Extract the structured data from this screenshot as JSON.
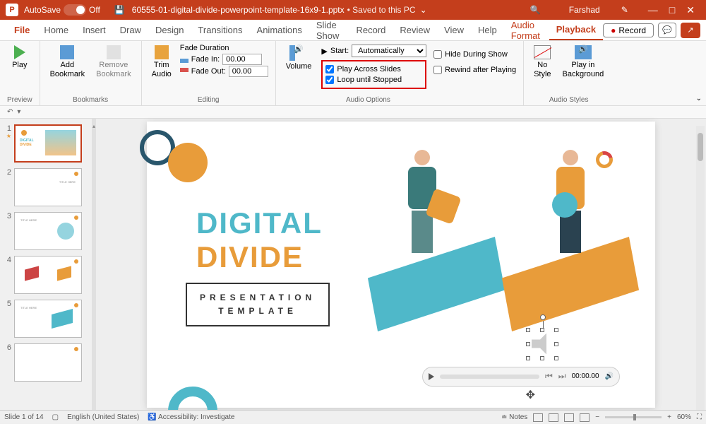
{
  "titlebar": {
    "autosave_label": "AutoSave",
    "autosave_state": "Off",
    "filename": "60555-01-digital-divide-powerpoint-template-16x9-1.pptx",
    "saved_status": "• Saved to this PC",
    "user": "Farshad"
  },
  "tabs": {
    "file": "File",
    "home": "Home",
    "insert": "Insert",
    "draw": "Draw",
    "design": "Design",
    "transitions": "Transitions",
    "animations": "Animations",
    "slideshow": "Slide Show",
    "record": "Record",
    "review": "Review",
    "view": "View",
    "help": "Help",
    "audio_format": "Audio Format",
    "playback": "Playback",
    "record_btn": "Record"
  },
  "ribbon": {
    "preview": {
      "play": "Play",
      "group": "Preview"
    },
    "bookmarks": {
      "add": "Add\nBookmark",
      "remove": "Remove\nBookmark",
      "group": "Bookmarks"
    },
    "editing": {
      "trim": "Trim\nAudio",
      "fade_duration": "Fade Duration",
      "fade_in_label": "Fade In:",
      "fade_in_val": "00.00",
      "fade_out_label": "Fade Out:",
      "fade_out_val": "00.00",
      "group": "Editing"
    },
    "audio_options": {
      "volume": "Volume",
      "start_label": "Start:",
      "start_val": "Automatically",
      "play_across": "Play Across Slides",
      "loop": "Loop until Stopped",
      "hide": "Hide During Show",
      "rewind": "Rewind after Playing",
      "group": "Audio Options"
    },
    "audio_styles": {
      "no_style": "No\nStyle",
      "play_bg": "Play in\nBackground",
      "group": "Audio Styles"
    }
  },
  "slide": {
    "title_l1": "DIGITAL",
    "title_l2": "DIVIDE",
    "sub_l1": "PRESENTATION",
    "sub_l2": "TEMPLATE"
  },
  "audio_player": {
    "time": "00:00.00"
  },
  "statusbar": {
    "slide": "Slide 1 of 14",
    "lang": "English (United States)",
    "access": "Accessibility: Investigate",
    "notes": "Notes",
    "zoom": "60%"
  },
  "thumbnails": [
    1,
    2,
    3,
    4,
    5,
    6
  ]
}
